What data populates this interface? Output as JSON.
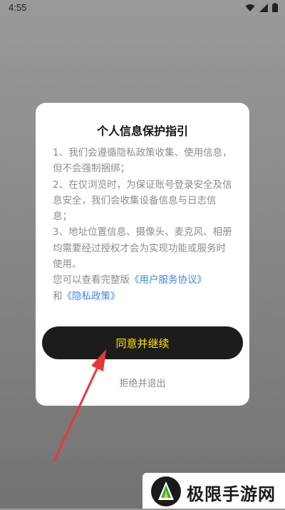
{
  "status_bar": {
    "time": "4:55",
    "icons": [
      "wifi-icon",
      "signal-icon",
      "battery-icon"
    ]
  },
  "dialog": {
    "title": "个人信息保护指引",
    "paragraphs": [
      "1、我们会遵循隐私政策收集、使用信息，但不会强制捆绑；",
      "2、在仅浏览时，为保证账号登录安全及信息安全，我们会收集设备信息与日志信息；",
      "3、地址位置信息、摄像头、麦克风、相册均需要经过授权才会为实现功能或服务时使用。"
    ],
    "footer_prefix": "您可以查看完整版",
    "service_link": "《用户服务协议》",
    "and_text": "和",
    "privacy_link": "《隐私政策》",
    "agree_button": "同意并继续",
    "refuse_button": "拒绝并退出"
  },
  "watermark": {
    "text": "极限手游网"
  },
  "colors": {
    "button_bg": "#1c1c1c",
    "button_text": "#ffe400",
    "link": "#3b86e8",
    "arrow": "#e8383d"
  }
}
